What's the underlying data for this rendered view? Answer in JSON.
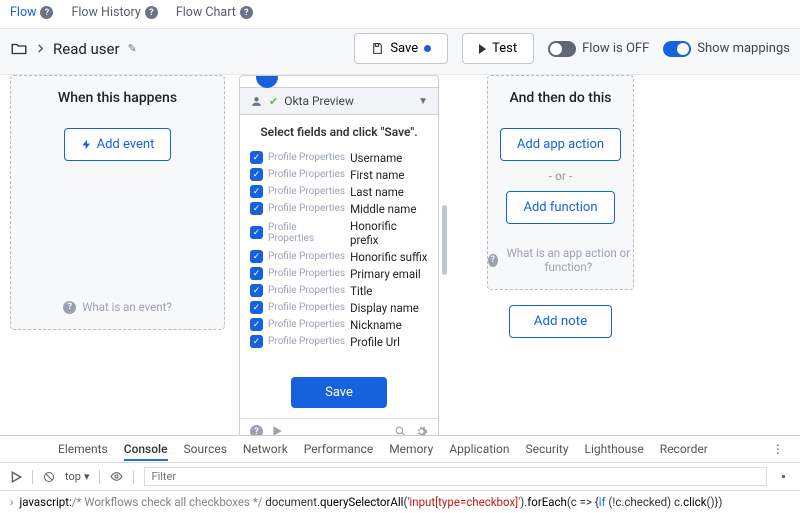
{
  "tabs": {
    "flow": "Flow",
    "history": "Flow History",
    "chart": "Flow Chart"
  },
  "header": {
    "title": "Read user"
  },
  "toolbar": {
    "save": "Save",
    "test": "Test",
    "flow_status": "Flow is OFF",
    "mappings": "Show mappings"
  },
  "left_panel": {
    "title": "When this happens",
    "button": "Add event",
    "help": "What is an event?"
  },
  "center": {
    "preview": "Okta Preview",
    "prompt": "Select fields and click \"Save\".",
    "save": "Save",
    "category": "Profile Properties",
    "fields": [
      "Username",
      "First name",
      "Last name",
      "Middle name",
      "Honorific prefix",
      "Honorific suffix",
      "Primary email",
      "Title",
      "Display name",
      "Nickname",
      "Profile Url"
    ]
  },
  "right_panel": {
    "title": "And then do this",
    "btn1": "Add app action",
    "or": "- or -",
    "btn2": "Add function",
    "help": "What is an app action or function?",
    "outside": "Add note"
  },
  "devtools": {
    "tabs": [
      "Elements",
      "Console",
      "Sources",
      "Network",
      "Performance",
      "Memory",
      "Application",
      "Security",
      "Lighthouse",
      "Recorder"
    ],
    "sub": {
      "top": "top",
      "filter_placeholder": "Filter"
    },
    "console_line": {
      "kw": "javascript:",
      "comment": "/* Workflows check all checkboxes */",
      "p1": " document.",
      "p2": "querySelectorAll",
      "p3": "(",
      "str": "'input[type=checkbox]'",
      "p4": ").",
      "p5": "forEach",
      "p6": "(c => {",
      "p7": "if",
      "p8": " (!c.checked) c.",
      "p9": "click",
      "p10": "()})"
    }
  }
}
